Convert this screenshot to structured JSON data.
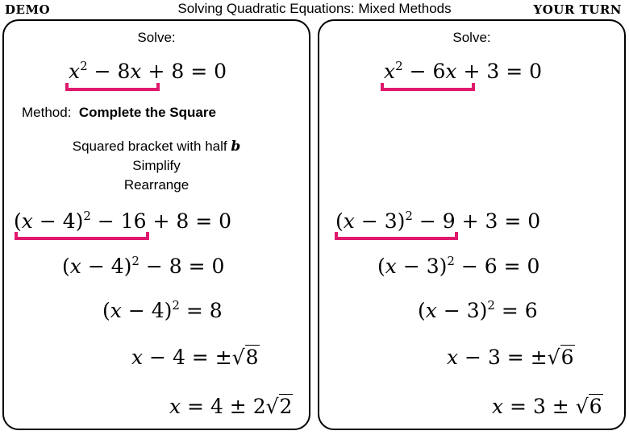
{
  "header": {
    "left_tag": "DEMO",
    "title": "Solving Quadratic Equations: Mixed Methods",
    "right_tag": "YOUR TURN"
  },
  "colors": {
    "bracket": "#e0196e",
    "border": "#000000"
  },
  "demo": {
    "solve_label": "Solve:",
    "equation": {
      "bracketed": [
        "x",
        "2",
        " − 8",
        "x"
      ],
      "rest": " + 8 = 0"
    },
    "method_label": "Method:",
    "method_name": "Complete the Square",
    "steps": [
      "Squared bracket with half",
      "b",
      "Simplify",
      "Rearrange"
    ],
    "lines": {
      "l1_a": "(",
      "l1_x": "x",
      "l1_b": " − 4)",
      "l1_sup": "2",
      "l1_c": " − 16",
      "l1_rest": " + 8 = 0",
      "l2_a": "(",
      "l2_x": "x",
      "l2_b": " − 4)",
      "l2_sup": "2",
      "l2_rest": " − 8 = 0",
      "l3_a": "(",
      "l3_x": "x",
      "l3_b": " − 4)",
      "l3_sup": "2",
      "l3_rest": " = 8",
      "l4_x": "x",
      "l4_rest": " − 4 = ±",
      "l4_rad": "8",
      "l5_x": "x",
      "l5_rest": " = 4 ± 2",
      "l5_rad": "2"
    }
  },
  "your_turn": {
    "solve_label": "Solve:",
    "equation": {
      "bracketed": [
        "x",
        "2",
        " − 6",
        "x"
      ],
      "rest": " + 3 = 0"
    },
    "lines": {
      "l1_a": "(",
      "l1_x": "x",
      "l1_b": " − 3)",
      "l1_sup": "2",
      "l1_c": " − 9",
      "l1_rest": " + 3 = 0",
      "l2_a": "(",
      "l2_x": "x",
      "l2_b": " − 3)",
      "l2_sup": "2",
      "l2_rest": " − 6 = 0",
      "l3_a": "(",
      "l3_x": "x",
      "l3_b": " − 3)",
      "l3_sup": "2",
      "l3_rest": " = 6",
      "l4_x": "x",
      "l4_rest": " − 3 = ±",
      "l4_rad": "6",
      "l5_x": "x",
      "l5_rest": " = 3 ± ",
      "l5_rad": "6"
    }
  }
}
